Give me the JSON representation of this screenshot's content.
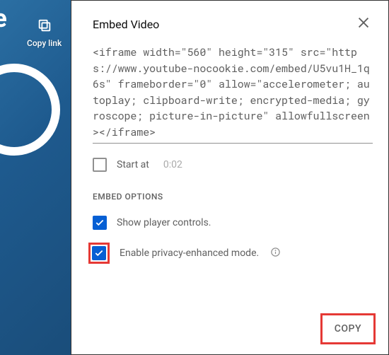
{
  "background": {
    "partial_text": "ire",
    "copy_link_label": "Copy link"
  },
  "panel": {
    "title": "Embed Video",
    "embed_code": "<iframe width=\"560\" height=\"315\" src=\"https://www.youtube-nocookie.com/embed/U5vu1H_1q6s\" frameborder=\"0\" allow=\"accelerometer; autoplay; clipboard-write; encrypted-media; gyroscope; picture-in-picture\" allowfullscreen></iframe>",
    "start_at": {
      "label": "Start at",
      "time": "0:02",
      "checked": false
    },
    "options_title": "EMBED OPTIONS",
    "options": {
      "show_controls": {
        "label": "Show player controls.",
        "checked": true
      },
      "privacy": {
        "label": "Enable privacy-enhanced mode.",
        "checked": true
      }
    },
    "copy_button": "COPY"
  }
}
